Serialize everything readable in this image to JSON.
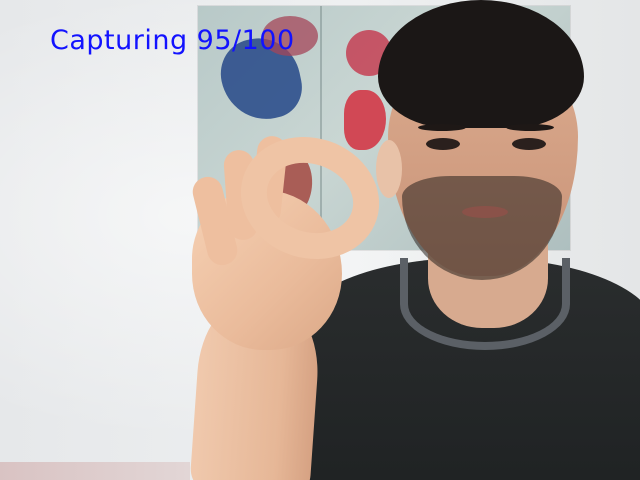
{
  "overlay": {
    "capture_status": "Capturing 95/100",
    "text_color": "#1212ff"
  },
  "scene": {
    "subject": "webcam-feed",
    "gesture": "ok-hand-sign"
  }
}
